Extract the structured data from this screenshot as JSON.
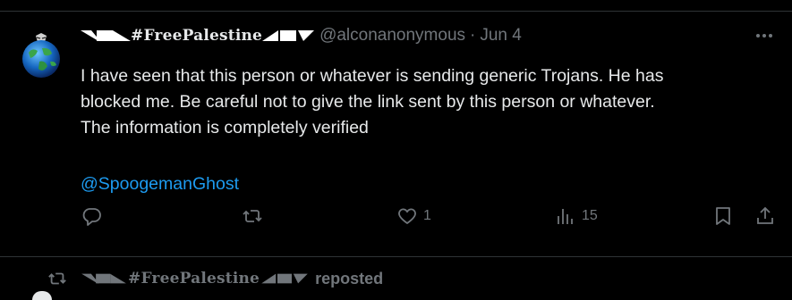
{
  "tweet": {
    "display_name": "#FreePalestine",
    "handle": "@alconanonymous",
    "separator": "·",
    "date": "Jun 4",
    "body_lines": [
      "I have seen that this person or whatever is sending generic Trojans. He has",
      "blocked me. Be careful not to give the link sent by this person or whatever.",
      "The information is completely verified"
    ],
    "mention": "@SpoogemanGhost",
    "actions": {
      "reply": {
        "icon": "reply-icon",
        "count": ""
      },
      "retweet": {
        "icon": "retweet-icon",
        "count": ""
      },
      "like": {
        "icon": "heart-icon",
        "count": "1"
      },
      "views": {
        "icon": "views-icon",
        "count": "15"
      },
      "bookmark": {
        "icon": "bookmark-icon"
      },
      "share": {
        "icon": "share-icon"
      }
    },
    "more_icon": "more-icon"
  },
  "repost_row": {
    "icon": "retweet-icon",
    "display_name": "#FreePalestine",
    "suffix": "reposted"
  },
  "colors": {
    "background": "#000000",
    "text": "#e7e9ea",
    "muted": "#71767b",
    "link": "#1d9bf0",
    "divider": "#2f3336"
  }
}
